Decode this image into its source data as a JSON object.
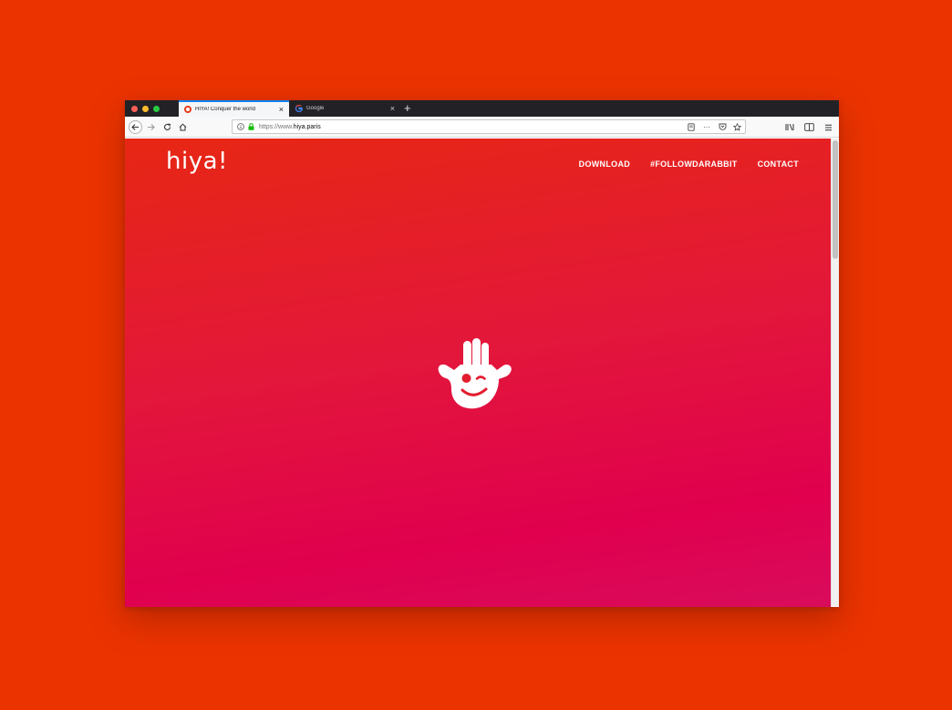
{
  "browser": {
    "tabs": [
      {
        "title": "HIYA! Conquer the world",
        "active": true,
        "favicon": "hiya-favicon"
      },
      {
        "title": "Google",
        "active": false,
        "favicon": "google-favicon"
      }
    ],
    "new_tab_label": "+",
    "close_label": "×",
    "url_prefix": "https://www.",
    "url_domain": "hiya.paris",
    "overflow_label": "···"
  },
  "site": {
    "logo": "hiya!",
    "nav": [
      "DOWNLOAD",
      "#FOLLOWDARABBIT",
      "CONTACT"
    ]
  },
  "colors": {
    "backdrop": "#eb3300",
    "gradient_top": "#e72714",
    "gradient_bottom": "#d90c5c",
    "tab_accent": "#0a84ff"
  }
}
